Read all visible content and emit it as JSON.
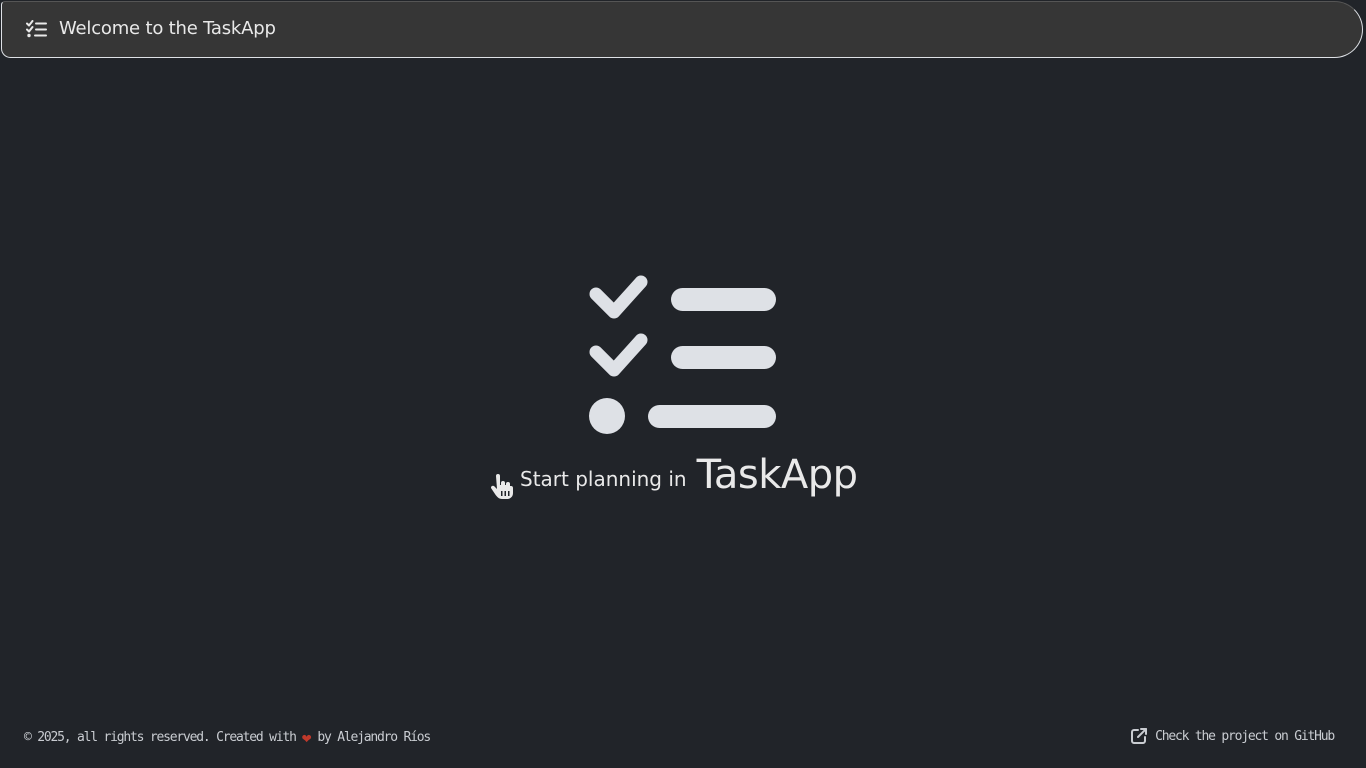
{
  "header": {
    "icon": "checklist-icon",
    "title": "Welcome to the TaskApp"
  },
  "hero": {
    "icon": "checklist-icon",
    "hand_icon": "pointer-hand-icon",
    "cta_text": "Start planning in",
    "brand": "TaskApp"
  },
  "footer": {
    "copyright_prefix": "© 2025, all rights reserved. Created with",
    "heart": "❤",
    "copyright_suffix": "by Alejandro Ríos",
    "github_icon": "external-link-icon",
    "github_label": "Check the project on GitHub"
  },
  "colors": {
    "background": "#212429",
    "header_background": "#363636",
    "text": "#dee1e6",
    "heart": "#c0392b"
  }
}
